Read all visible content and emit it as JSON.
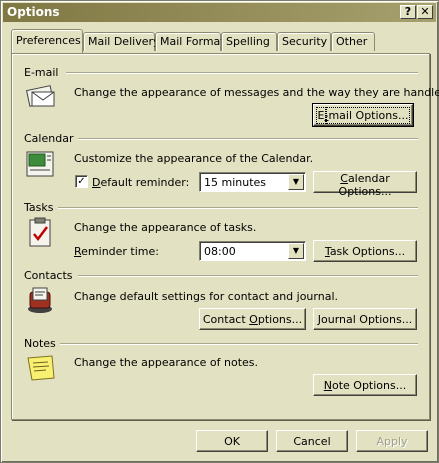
{
  "window": {
    "title": "Options",
    "help_label": "?",
    "close_label": "✕"
  },
  "tabs": [
    {
      "label": "Preferences",
      "active": true
    },
    {
      "label": "Mail Delivery",
      "active": false
    },
    {
      "label": "Mail Format",
      "active": false
    },
    {
      "label": "Spelling",
      "active": false
    },
    {
      "label": "Security",
      "active": false
    },
    {
      "label": "Other",
      "active": false
    }
  ],
  "email": {
    "heading": "E-mail",
    "description": "Change the appearance of messages and the way they are handled.",
    "button": {
      "pre": "E",
      "key": "-",
      "post": "mail Options..."
    }
  },
  "calendar": {
    "heading": "Calendar",
    "description": "Customize the appearance of the Calendar.",
    "reminder_checked": true,
    "reminder_label": {
      "pre": "",
      "key": "D",
      "post": "efault reminder:"
    },
    "reminder_value": "15 minutes",
    "button": {
      "pre": "",
      "key": "C",
      "post": "alendar Options..."
    }
  },
  "tasks": {
    "heading": "Tasks",
    "description": "Change the appearance of tasks.",
    "time_label": {
      "pre": "",
      "key": "R",
      "post": "eminder time:"
    },
    "time_value": "08:00",
    "button": {
      "pre": "",
      "key": "T",
      "post": "ask Options..."
    }
  },
  "contacts": {
    "heading": "Contacts",
    "description": "Change default settings for contact and journal.",
    "contact_button": {
      "pre": "Contact ",
      "key": "O",
      "post": "ptions..."
    },
    "journal_button": {
      "pre": "",
      "key": "J",
      "post": "ournal Options..."
    }
  },
  "notes": {
    "heading": "Notes",
    "description": "Change the appearance of notes.",
    "button": {
      "pre": "",
      "key": "N",
      "post": "ote Options..."
    }
  },
  "footer": {
    "ok": "OK",
    "cancel": "Cancel",
    "apply": "Apply"
  },
  "icons": {
    "email": "envelope-icon",
    "calendar": "calendar-icon",
    "tasks": "task-clipboard-icon",
    "contacts": "rolodex-icon",
    "notes": "sticky-note-icon"
  },
  "colors": {
    "face": "#e2e1c2",
    "titlebar": "#807843",
    "text": "#000000"
  }
}
